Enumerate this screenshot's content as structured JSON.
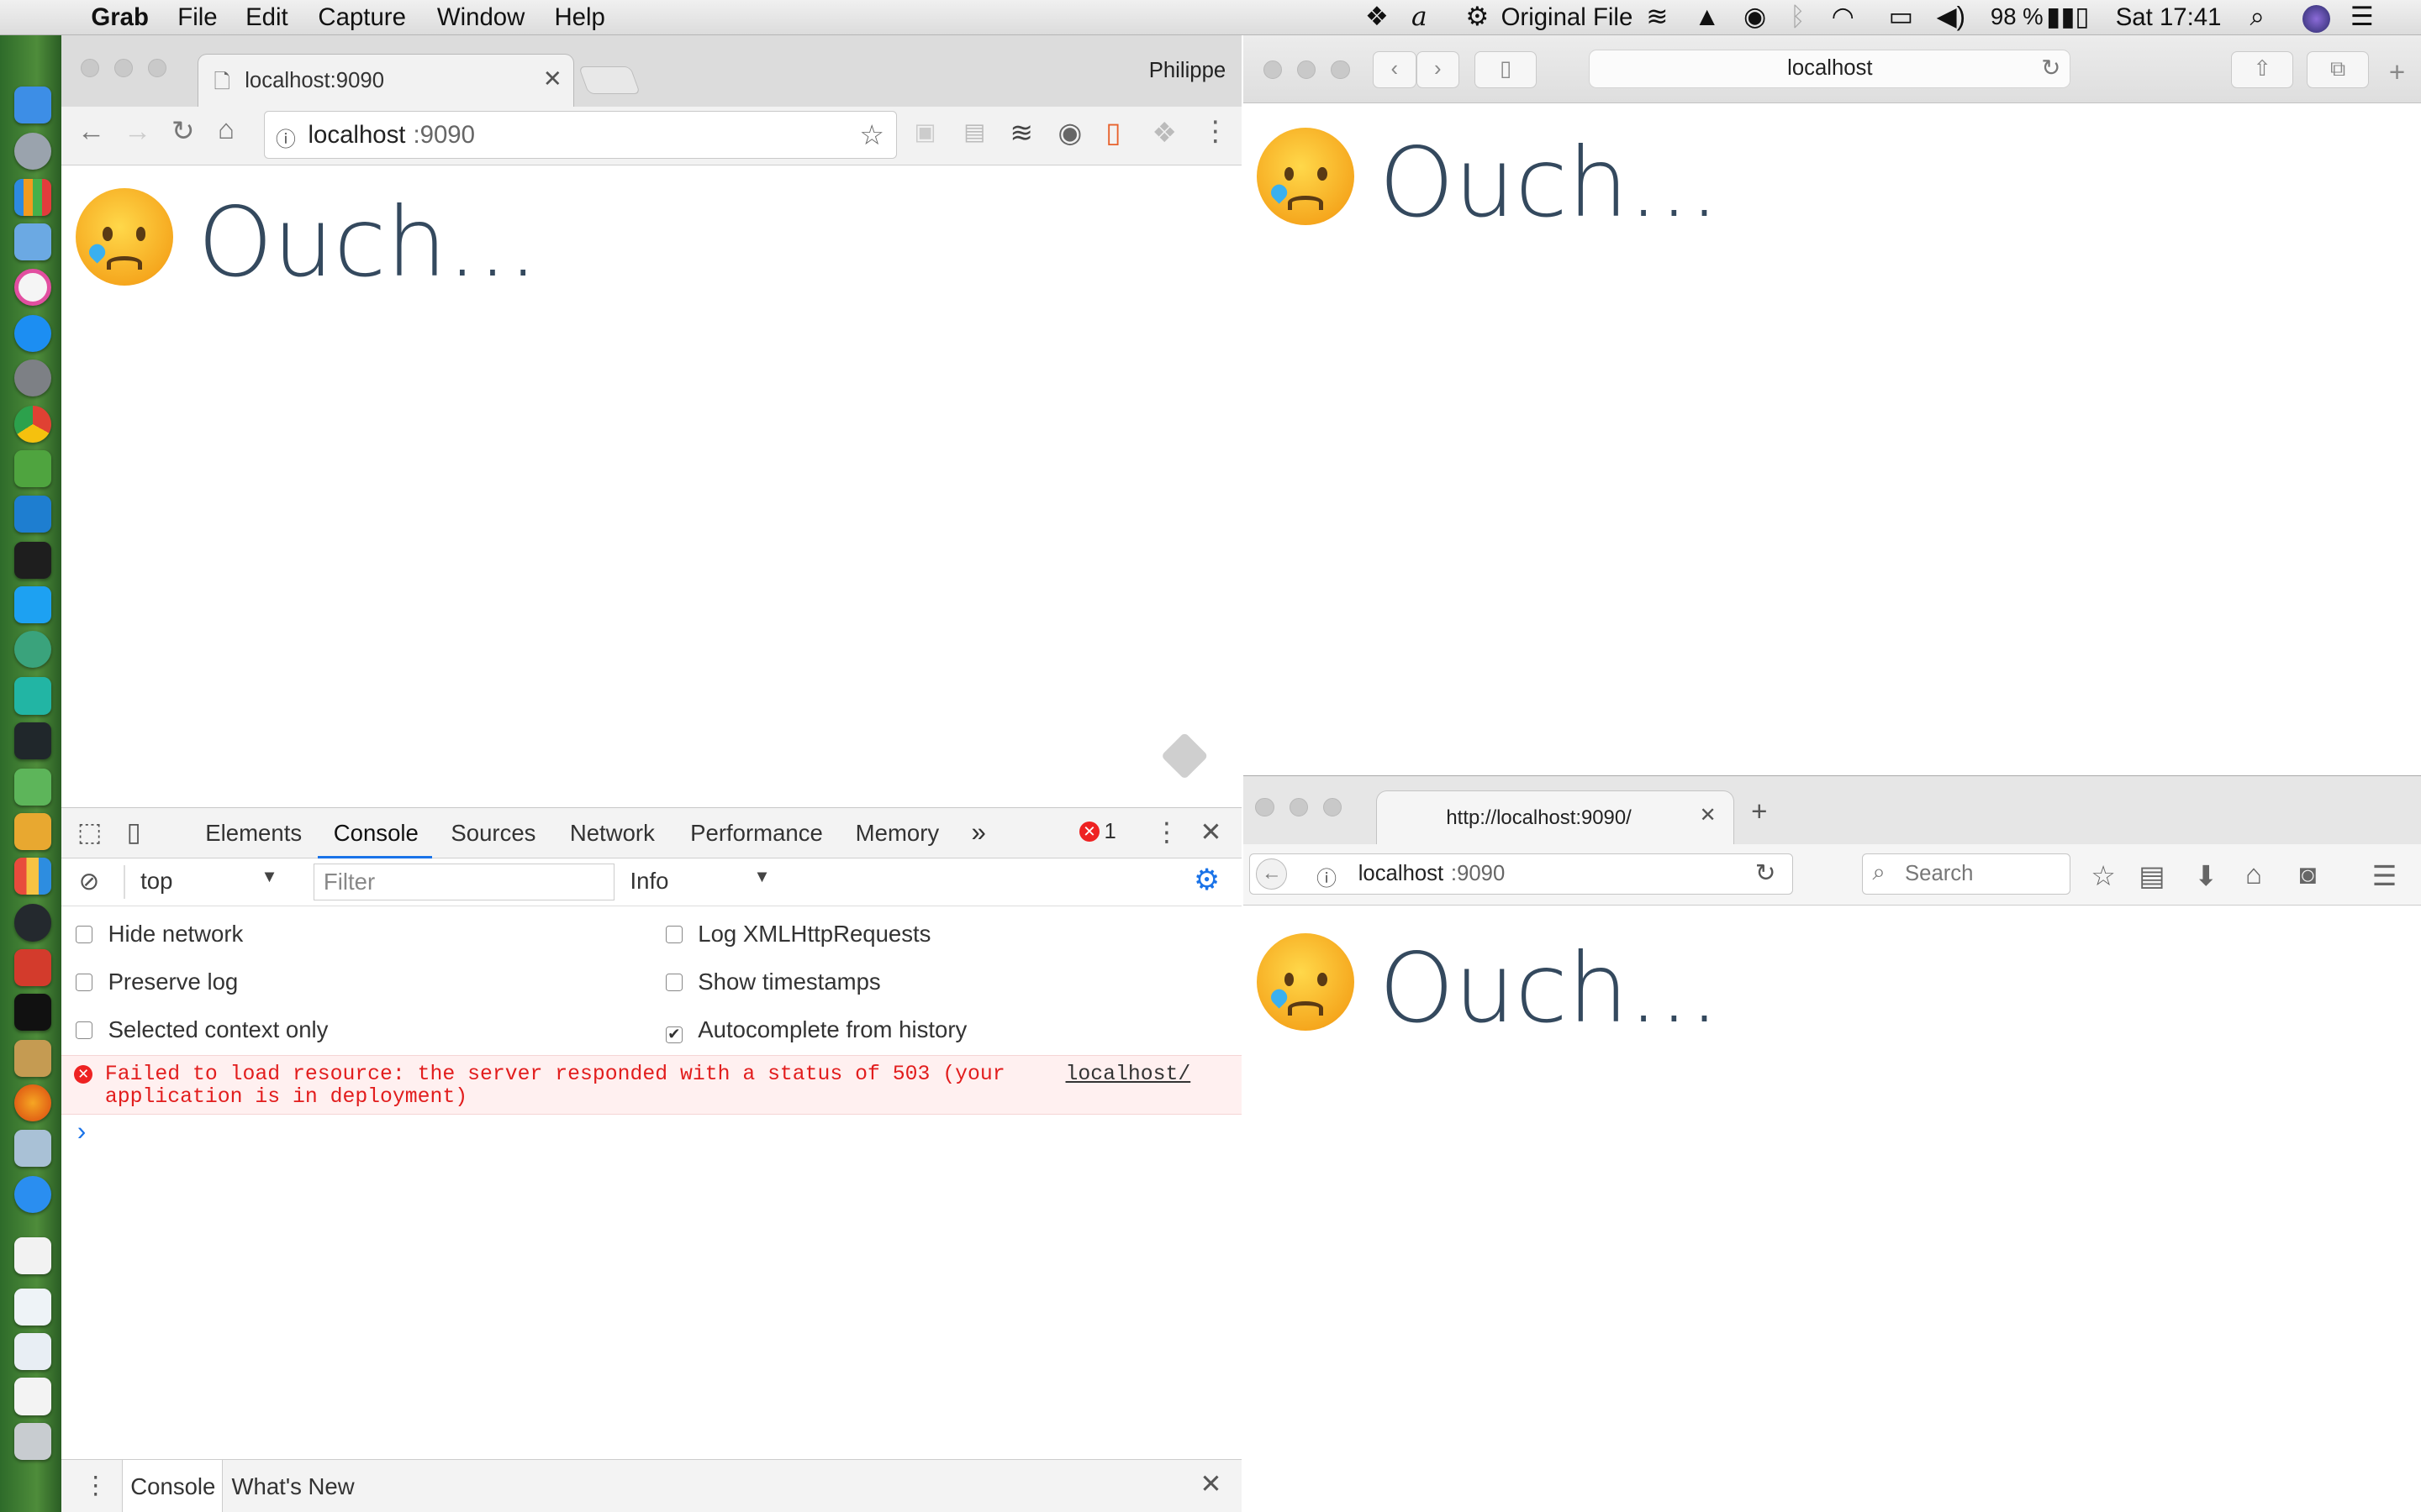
{
  "menubar": {
    "app": "Grab",
    "items": [
      "File",
      "Edit",
      "Capture",
      "Window",
      "Help"
    ],
    "status_item": "Original File",
    "battery": "98 %",
    "clock": "Sat 17:41"
  },
  "chrome": {
    "tab_title": "localhost:9090",
    "profile": "Philippe",
    "url_host": "localhost",
    "url_port": ":9090",
    "page_heading": "Ouch...",
    "devtools": {
      "tabs": [
        "Elements",
        "Console",
        "Sources",
        "Network",
        "Performance",
        "Memory"
      ],
      "overflow": "»",
      "error_count": "1",
      "context": "top",
      "filter_placeholder": "Filter",
      "level": "Info",
      "options_left": [
        "Hide network",
        "Preserve log",
        "Selected context only"
      ],
      "options_right": [
        "Log XMLHttpRequests",
        "Show timestamps",
        "Autocomplete from history"
      ],
      "error_line1": "Failed to load resource: the server responded with a status of 503 (your",
      "error_line2": "application is in deployment)",
      "error_source": "localhost/",
      "prompt": "›",
      "drawer_tabs": [
        "Console",
        "What's New"
      ]
    }
  },
  "safari": {
    "address": "localhost",
    "page_heading": "Ouch..."
  },
  "firefox": {
    "tab_title": "http://localhost:9090/",
    "url_host": "localhost",
    "url_port": ":9090",
    "search_placeholder": "Search",
    "page_heading": "Ouch..."
  },
  "icons": {
    "apple": "apple-logo-icon",
    "emoji": "crying-face-icon"
  },
  "colors": {
    "heading": "#34495e",
    "error_text": "#e21d1d",
    "console_tab_underline": "#1a73e8"
  }
}
